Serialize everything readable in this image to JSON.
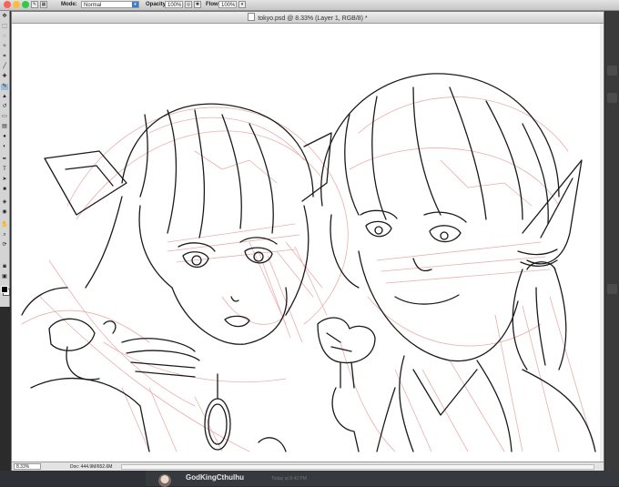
{
  "options_bar": {
    "mode_label": "Mode:",
    "mode_value": "Normal",
    "opacity_label": "Opacity:",
    "opacity_value": "100%",
    "flow_label": "Flow:",
    "flow_value": "100%"
  },
  "document": {
    "title": "tokyo.psd @ 8.33% (Layer 1, RGB/8) *",
    "zoom": "8.33%",
    "doc_size": "Doc: 444.9M/652.6M"
  },
  "chat": {
    "username": "GodKingCthulhu",
    "timestamp": "Today at 8:43 PM"
  },
  "colors": {
    "sketch_line": "#1a1a1a",
    "rough_line": "#e8a5a5",
    "accent": "#3a7bd5"
  }
}
